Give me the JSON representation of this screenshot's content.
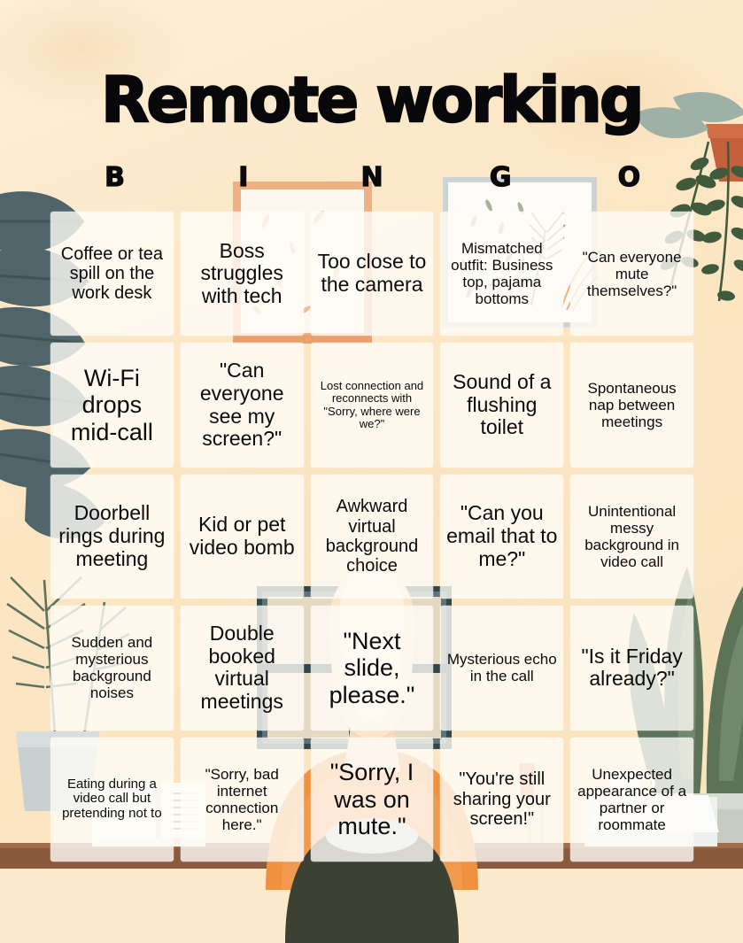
{
  "title": "Remote working",
  "columns": [
    "B",
    "I",
    "N",
    "G",
    "O"
  ],
  "colors": {
    "background": "#fce8c9",
    "text": "#0b0b0d",
    "cell_fill": "#fffdf7",
    "leaf_dark": "#4f6569",
    "leaf_green": "#3f5b3c",
    "desk_brown": "#8b5a3c",
    "shirt_orange": "#f0913f",
    "chair_olive": "#3c4233",
    "frame_tan": "#efb183",
    "monitor_teal": "#2f484b"
  },
  "cells": [
    {
      "text": "Coffee or tea spill on the work desk",
      "size": "fs-md"
    },
    {
      "text": "Boss struggles with tech",
      "size": "fs-lg"
    },
    {
      "text": "Too close to the camera",
      "size": "fs-lg"
    },
    {
      "text": "Mismatched outfit: Business top, pajama bottoms",
      "size": "fs-sm"
    },
    {
      "text": "\"Can everyone mute themselves?\"",
      "size": "fs-sm"
    },
    {
      "text": "Wi-Fi drops mid-call",
      "size": "fs-xl"
    },
    {
      "text": "\"Can everyone see my screen?\"",
      "size": "fs-lg"
    },
    {
      "text": "Lost connection and reconnects with \"Sorry, where were we?\"",
      "size": "fs-xxs"
    },
    {
      "text": "Sound of a flushing toilet",
      "size": "fs-lg"
    },
    {
      "text": "Spontaneous nap between meetings",
      "size": "fs-sm"
    },
    {
      "text": "Doorbell rings during meeting",
      "size": "fs-lg"
    },
    {
      "text": "Kid or pet video bomb",
      "size": "fs-lg"
    },
    {
      "text": "Awkward virtual background choice",
      "size": "fs-md"
    },
    {
      "text": "\"Can you email that to me?\"",
      "size": "fs-lg"
    },
    {
      "text": "Unintentional messy background in video call",
      "size": "fs-sm"
    },
    {
      "text": "Sudden and mysterious background noises",
      "size": "fs-sm"
    },
    {
      "text": "Double booked virtual meetings",
      "size": "fs-lg"
    },
    {
      "text": "\"Next slide, please.\"",
      "size": "fs-xl"
    },
    {
      "text": "Mysterious echo in the call",
      "size": "fs-sm"
    },
    {
      "text": "\"Is it Friday already?\"",
      "size": "fs-lg"
    },
    {
      "text": "Eating during a video call but pretending not to",
      "size": "fs-xs"
    },
    {
      "text": "\"Sorry, bad internet connection here.\"",
      "size": "fs-sm"
    },
    {
      "text": "\"Sorry, I was on mute.\"",
      "size": "fs-xl"
    },
    {
      "text": "\"You're still sharing your screen!\"",
      "size": "fs-md"
    },
    {
      "text": "Unexpected appearance of a partner or roommate",
      "size": "fs-sm"
    }
  ]
}
